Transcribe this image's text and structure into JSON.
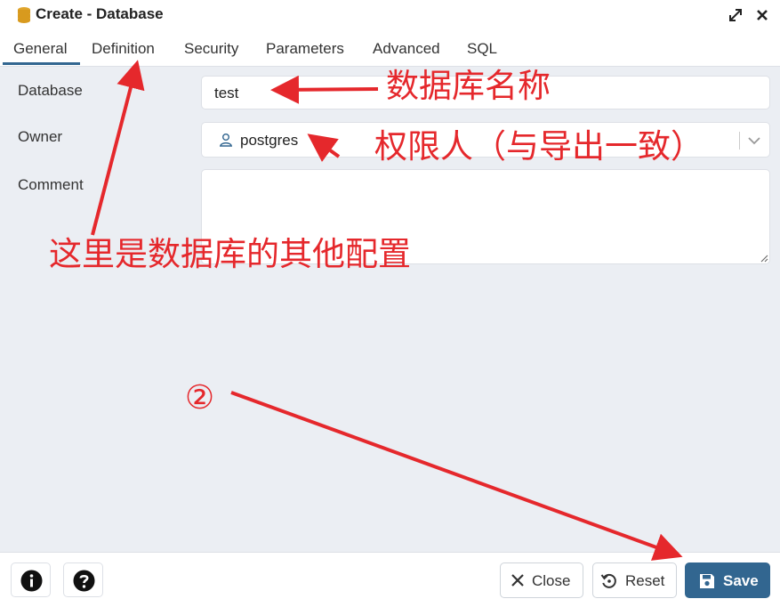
{
  "window": {
    "title": "Create - Database",
    "icons": {
      "app": "database-icon",
      "maximize": "maximize-icon",
      "close": "close-icon"
    }
  },
  "tabs": [
    {
      "label": "General",
      "active": true
    },
    {
      "label": "Definition"
    },
    {
      "label": "Security"
    },
    {
      "label": "Parameters"
    },
    {
      "label": "Advanced"
    },
    {
      "label": "SQL"
    }
  ],
  "form": {
    "database": {
      "label": "Database",
      "value": "test"
    },
    "owner": {
      "label": "Owner",
      "value": "postgres",
      "icon": "user-icon"
    },
    "comment": {
      "label": "Comment",
      "value": ""
    }
  },
  "footer": {
    "info_icon": "info-icon",
    "help_icon": "help-icon",
    "close_label": "Close",
    "reset_label": "Reset",
    "save_label": "Save"
  },
  "annotations": {
    "db_name": "数据库名称",
    "owner": "权限人（与导出一致）",
    "other_config": "这里是数据库的其他配置",
    "step": "②"
  },
  "colors": {
    "accent": "#326690",
    "annotation": "#e5282c",
    "body_bg": "#ebeef3"
  }
}
